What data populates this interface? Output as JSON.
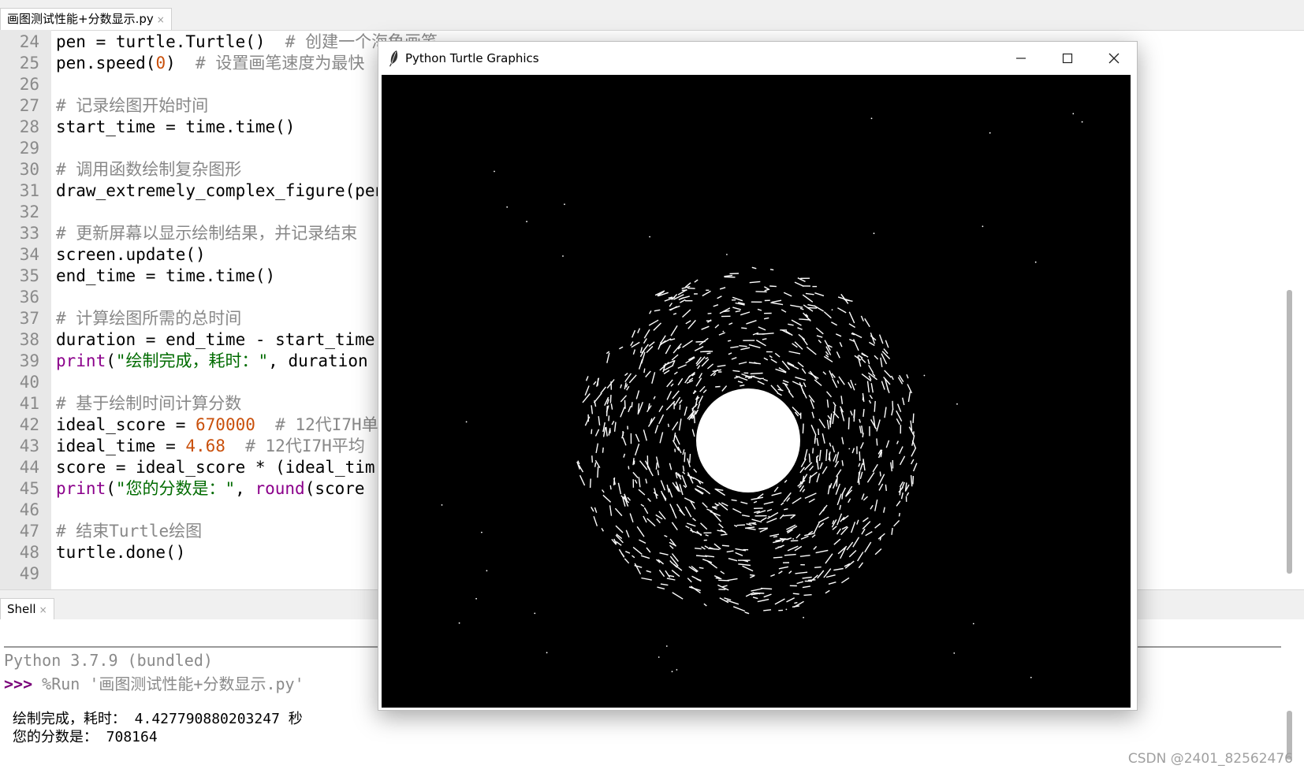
{
  "editor": {
    "tab_label": "画图测试性能+分数显示.py",
    "tab_close": "×",
    "lines": [
      {
        "num": "24",
        "segments": [
          {
            "t": "pen = turtle.Turtle()  ",
            "c": ""
          },
          {
            "t": "# 创建一个海龟画笔",
            "c": "cm"
          }
        ]
      },
      {
        "num": "25",
        "segments": [
          {
            "t": "pen.speed(",
            "c": ""
          },
          {
            "t": "0",
            "c": "num"
          },
          {
            "t": ")  ",
            "c": ""
          },
          {
            "t": "# 设置画笔速度为最快",
            "c": "cm"
          }
        ]
      },
      {
        "num": "26",
        "segments": []
      },
      {
        "num": "27",
        "segments": [
          {
            "t": "# 记录绘图开始时间",
            "c": "cm"
          }
        ]
      },
      {
        "num": "28",
        "segments": [
          {
            "t": "start_time = time.time()",
            "c": ""
          }
        ]
      },
      {
        "num": "29",
        "segments": []
      },
      {
        "num": "30",
        "segments": [
          {
            "t": "# 调用函数绘制复杂图形",
            "c": "cm"
          }
        ]
      },
      {
        "num": "31",
        "segments": [
          {
            "t": "draw_extremely_complex_figure(pen",
            "c": ""
          }
        ]
      },
      {
        "num": "32",
        "segments": []
      },
      {
        "num": "33",
        "segments": [
          {
            "t": "# 更新屏幕以显示绘制结果，并记录结束",
            "c": "cm"
          }
        ]
      },
      {
        "num": "34",
        "segments": [
          {
            "t": "screen.update()",
            "c": ""
          }
        ]
      },
      {
        "num": "35",
        "segments": [
          {
            "t": "end_time = time.time()",
            "c": ""
          }
        ]
      },
      {
        "num": "36",
        "segments": []
      },
      {
        "num": "37",
        "segments": [
          {
            "t": "# 计算绘图所需的总时间",
            "c": "cm"
          }
        ]
      },
      {
        "num": "38",
        "segments": [
          {
            "t": "duration = end_time - start_time",
            "c": ""
          }
        ]
      },
      {
        "num": "39",
        "segments": [
          {
            "t": "print",
            "c": "bi"
          },
          {
            "t": "(",
            "c": ""
          },
          {
            "t": "\"绘制完成，耗时：\"",
            "c": "str"
          },
          {
            "t": ", duration",
            "c": ""
          }
        ]
      },
      {
        "num": "40",
        "segments": []
      },
      {
        "num": "41",
        "segments": [
          {
            "t": "# 基于绘制时间计算分数",
            "c": "cm"
          }
        ]
      },
      {
        "num": "42",
        "segments": [
          {
            "t": "ideal_score = ",
            "c": ""
          },
          {
            "t": "670000",
            "c": "num"
          },
          {
            "t": "  ",
            "c": ""
          },
          {
            "t": "# 12代I7H单",
            "c": "cm"
          }
        ]
      },
      {
        "num": "43",
        "segments": [
          {
            "t": "ideal_time = ",
            "c": ""
          },
          {
            "t": "4.68",
            "c": "num"
          },
          {
            "t": "  ",
            "c": ""
          },
          {
            "t": "# 12代I7H平均",
            "c": "cm"
          }
        ]
      },
      {
        "num": "44",
        "segments": [
          {
            "t": "score = ideal_score * (ideal_tim",
            "c": ""
          }
        ]
      },
      {
        "num": "45",
        "segments": [
          {
            "t": "print",
            "c": "bi"
          },
          {
            "t": "(",
            "c": ""
          },
          {
            "t": "\"您的分数是：\"",
            "c": "str"
          },
          {
            "t": ", ",
            "c": ""
          },
          {
            "t": "round",
            "c": "bi"
          },
          {
            "t": "(score",
            "c": ""
          }
        ]
      },
      {
        "num": "46",
        "segments": []
      },
      {
        "num": "47",
        "segments": [
          {
            "t": "# 结束Turtle绘图",
            "c": "cm"
          }
        ]
      },
      {
        "num": "48",
        "segments": [
          {
            "t": "turtle.done()",
            "c": ""
          }
        ]
      },
      {
        "num": "49",
        "segments": []
      }
    ]
  },
  "shell": {
    "tab_label": "Shell",
    "tab_close": "×",
    "version_line": "Python 3.7.9 (bundled)",
    "prompt": ">>>",
    "command": " %Run '画图测试性能+分数显示.py'",
    "output": [
      " 绘制完成，耗时： 4.427790880203247 秒",
      " 您的分数是： 708164"
    ]
  },
  "turtle_window": {
    "title": "Python Turtle Graphics",
    "icon": "feather-icon",
    "buttons": [
      "minimize-icon",
      "maximize-icon",
      "close-icon"
    ],
    "canvas_background": "#000000",
    "drawing_color": "#ffffff"
  },
  "watermark": "CSDN @2401_82562476",
  "colors": {
    "comment": "#888888",
    "number": "#c9500b",
    "string": "#006b00",
    "builtin": "#8b008b",
    "prompt": "#7a007a"
  }
}
